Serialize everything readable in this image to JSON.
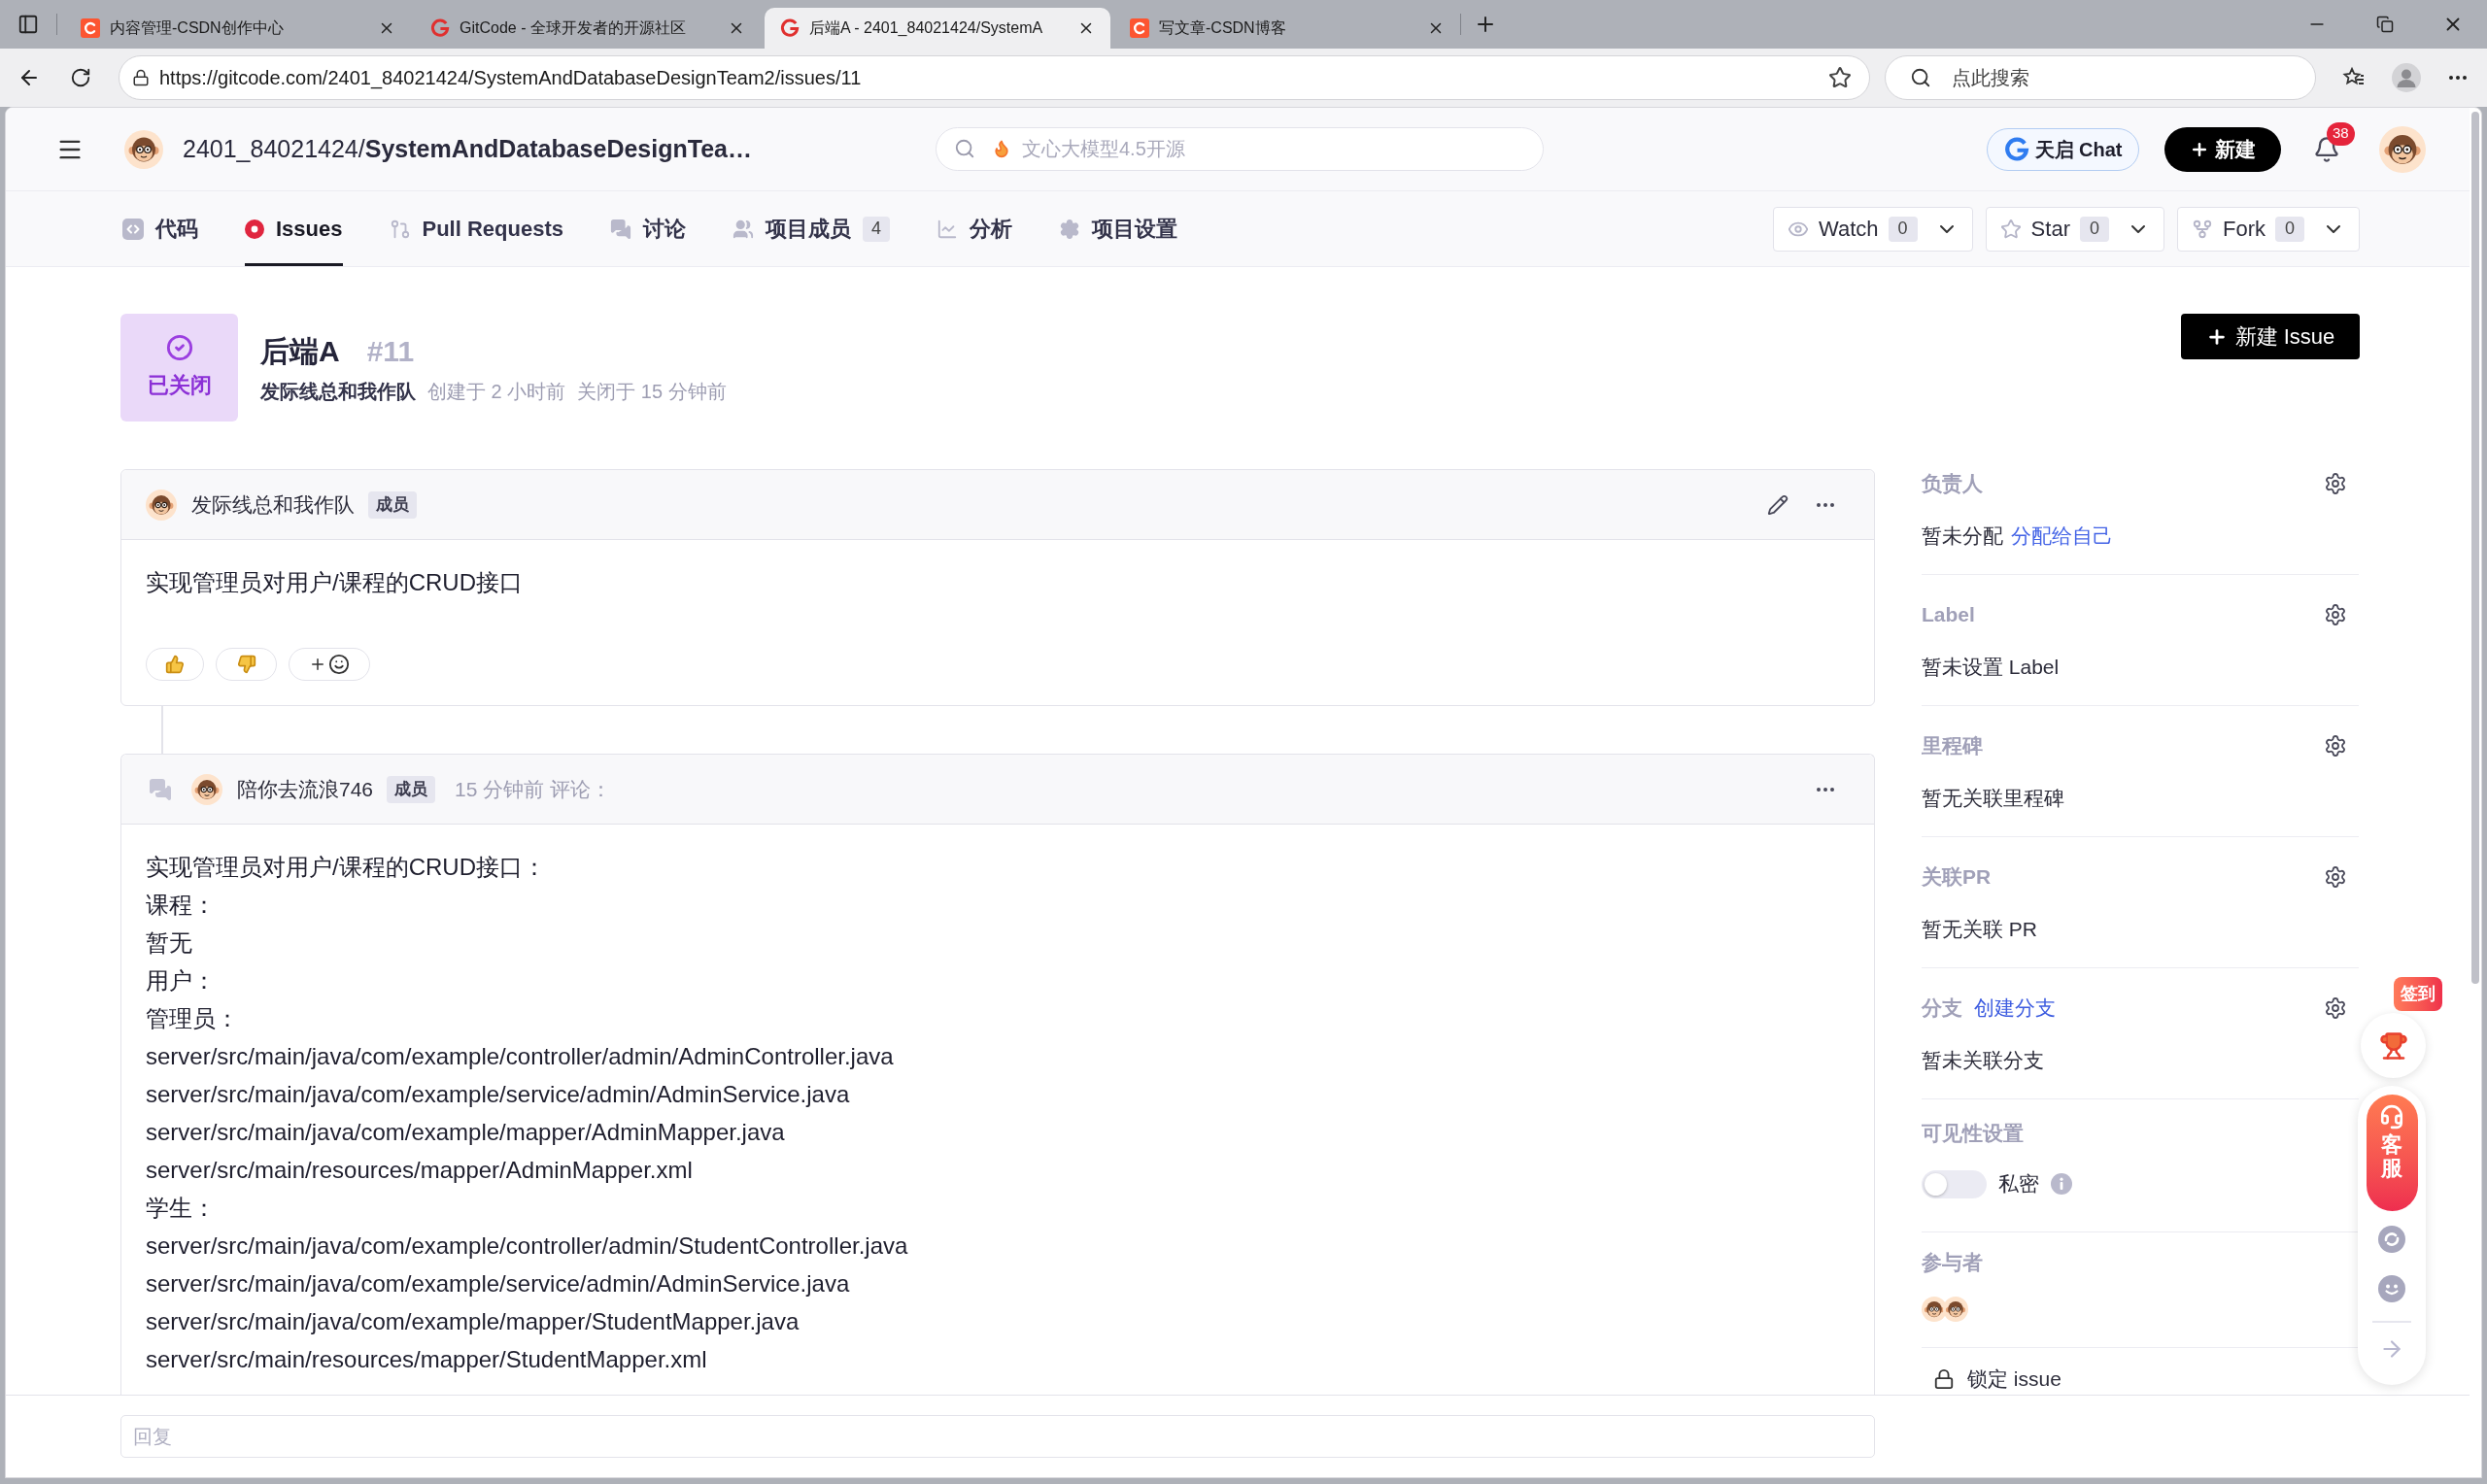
{
  "browser": {
    "tabs": [
      {
        "title": "内容管理-CSDN创作中心",
        "kind": "tile",
        "selected": false
      },
      {
        "title": "GitCode - 全球开发者的开源社区",
        "kind": "glyph",
        "selected": false
      },
      {
        "title": "后端A - 2401_84021424/SystemA",
        "kind": "glyph",
        "selected": true
      },
      {
        "title": "写文章-CSDN博客",
        "kind": "tile",
        "selected": false
      }
    ],
    "url": "https://gitcode.com/2401_84021424/SystemAndDatabaseDesignTeam2/issues/11",
    "search": {
      "placeholder": "点此搜索"
    }
  },
  "header": {
    "repo": "2401_84021424/**SystemAndDatabaseDesignTea…**",
    "search": {
      "placeholder": "文心大模型4.5开源"
    },
    "chat_button": "天启 Chat",
    "new_button": "新建",
    "notification_count": "38"
  },
  "nav": {
    "tabs": [
      {
        "label": "代码",
        "selected": false
      },
      {
        "label": "Issues",
        "selected": true
      },
      {
        "label": "Pull Requests",
        "selected": false
      },
      {
        "label": "讨论",
        "selected": false
      },
      {
        "label": "项目成员",
        "count": "4",
        "selected": false
      },
      {
        "label": "分析",
        "selected": false
      },
      {
        "label": "项目设置",
        "selected": false
      }
    ],
    "actions": [
      {
        "label": "Watch",
        "count": "0"
      },
      {
        "label": "Star",
        "count": "0"
      },
      {
        "label": "Fork",
        "count": "0"
      }
    ]
  },
  "issue": {
    "status": {
      "label": "已关闭",
      "kind": "closed"
    },
    "title": "后端A",
    "number": "#11",
    "author": "发际线总和我作队",
    "created": "创建于 2 小时前",
    "closed": "关闭于 15 分钟前",
    "new_issue_button": "新建 Issue"
  },
  "comments": [
    {
      "kind": "description",
      "author": "发际线总和我作队",
      "role": "成员",
      "body": [
        "实现管理员对用户/课程的CRUD接口"
      ]
    },
    {
      "kind": "comment",
      "author": "陪你去流浪746",
      "role": "成员",
      "time": "15 分钟前 评论：",
      "body": [
        "实现管理员对用户/课程的CRUD接口：",
        "课程：",
        "暂无",
        "用户：",
        "管理员：",
        "server/src/main/java/com/example/controller/admin/AdminController.java",
        "server/src/main/java/com/example/service/admin/AdminService.java",
        "server/src/main/java/com/example/mapper/AdminMapper.java",
        "server/src/main/resources/mapper/AdminMapper.xml",
        "学生：",
        "server/src/main/java/com/example/controller/admin/StudentController.java",
        "server/src/main/java/com/example/service/admin/AdminService.java",
        "server/src/main/java/com/example/mapper/StudentMapper.java",
        "server/src/main/resources/mapper/StudentMapper.xml"
      ]
    }
  ],
  "sidebar": {
    "sections": [
      {
        "title": "负责人",
        "value": "暂未分配",
        "link": "分配给自己"
      },
      {
        "title": "Label",
        "value": "暂未设置 Label"
      },
      {
        "title": "里程碑",
        "value": "暂无关联里程碑"
      },
      {
        "title": "关联PR",
        "value": "暂无关联 PR"
      },
      {
        "title": "分支",
        "title_link": "创建分支",
        "value": "暂未关联分支"
      }
    ],
    "visibility": {
      "title": "可见性设置",
      "label": "私密",
      "on": false
    },
    "participants": {
      "title": "参与者"
    },
    "lock": "锁定 issue"
  },
  "float_bar": {
    "badge": "签到",
    "service": "客服"
  },
  "reply": {
    "placeholder": "回复"
  }
}
